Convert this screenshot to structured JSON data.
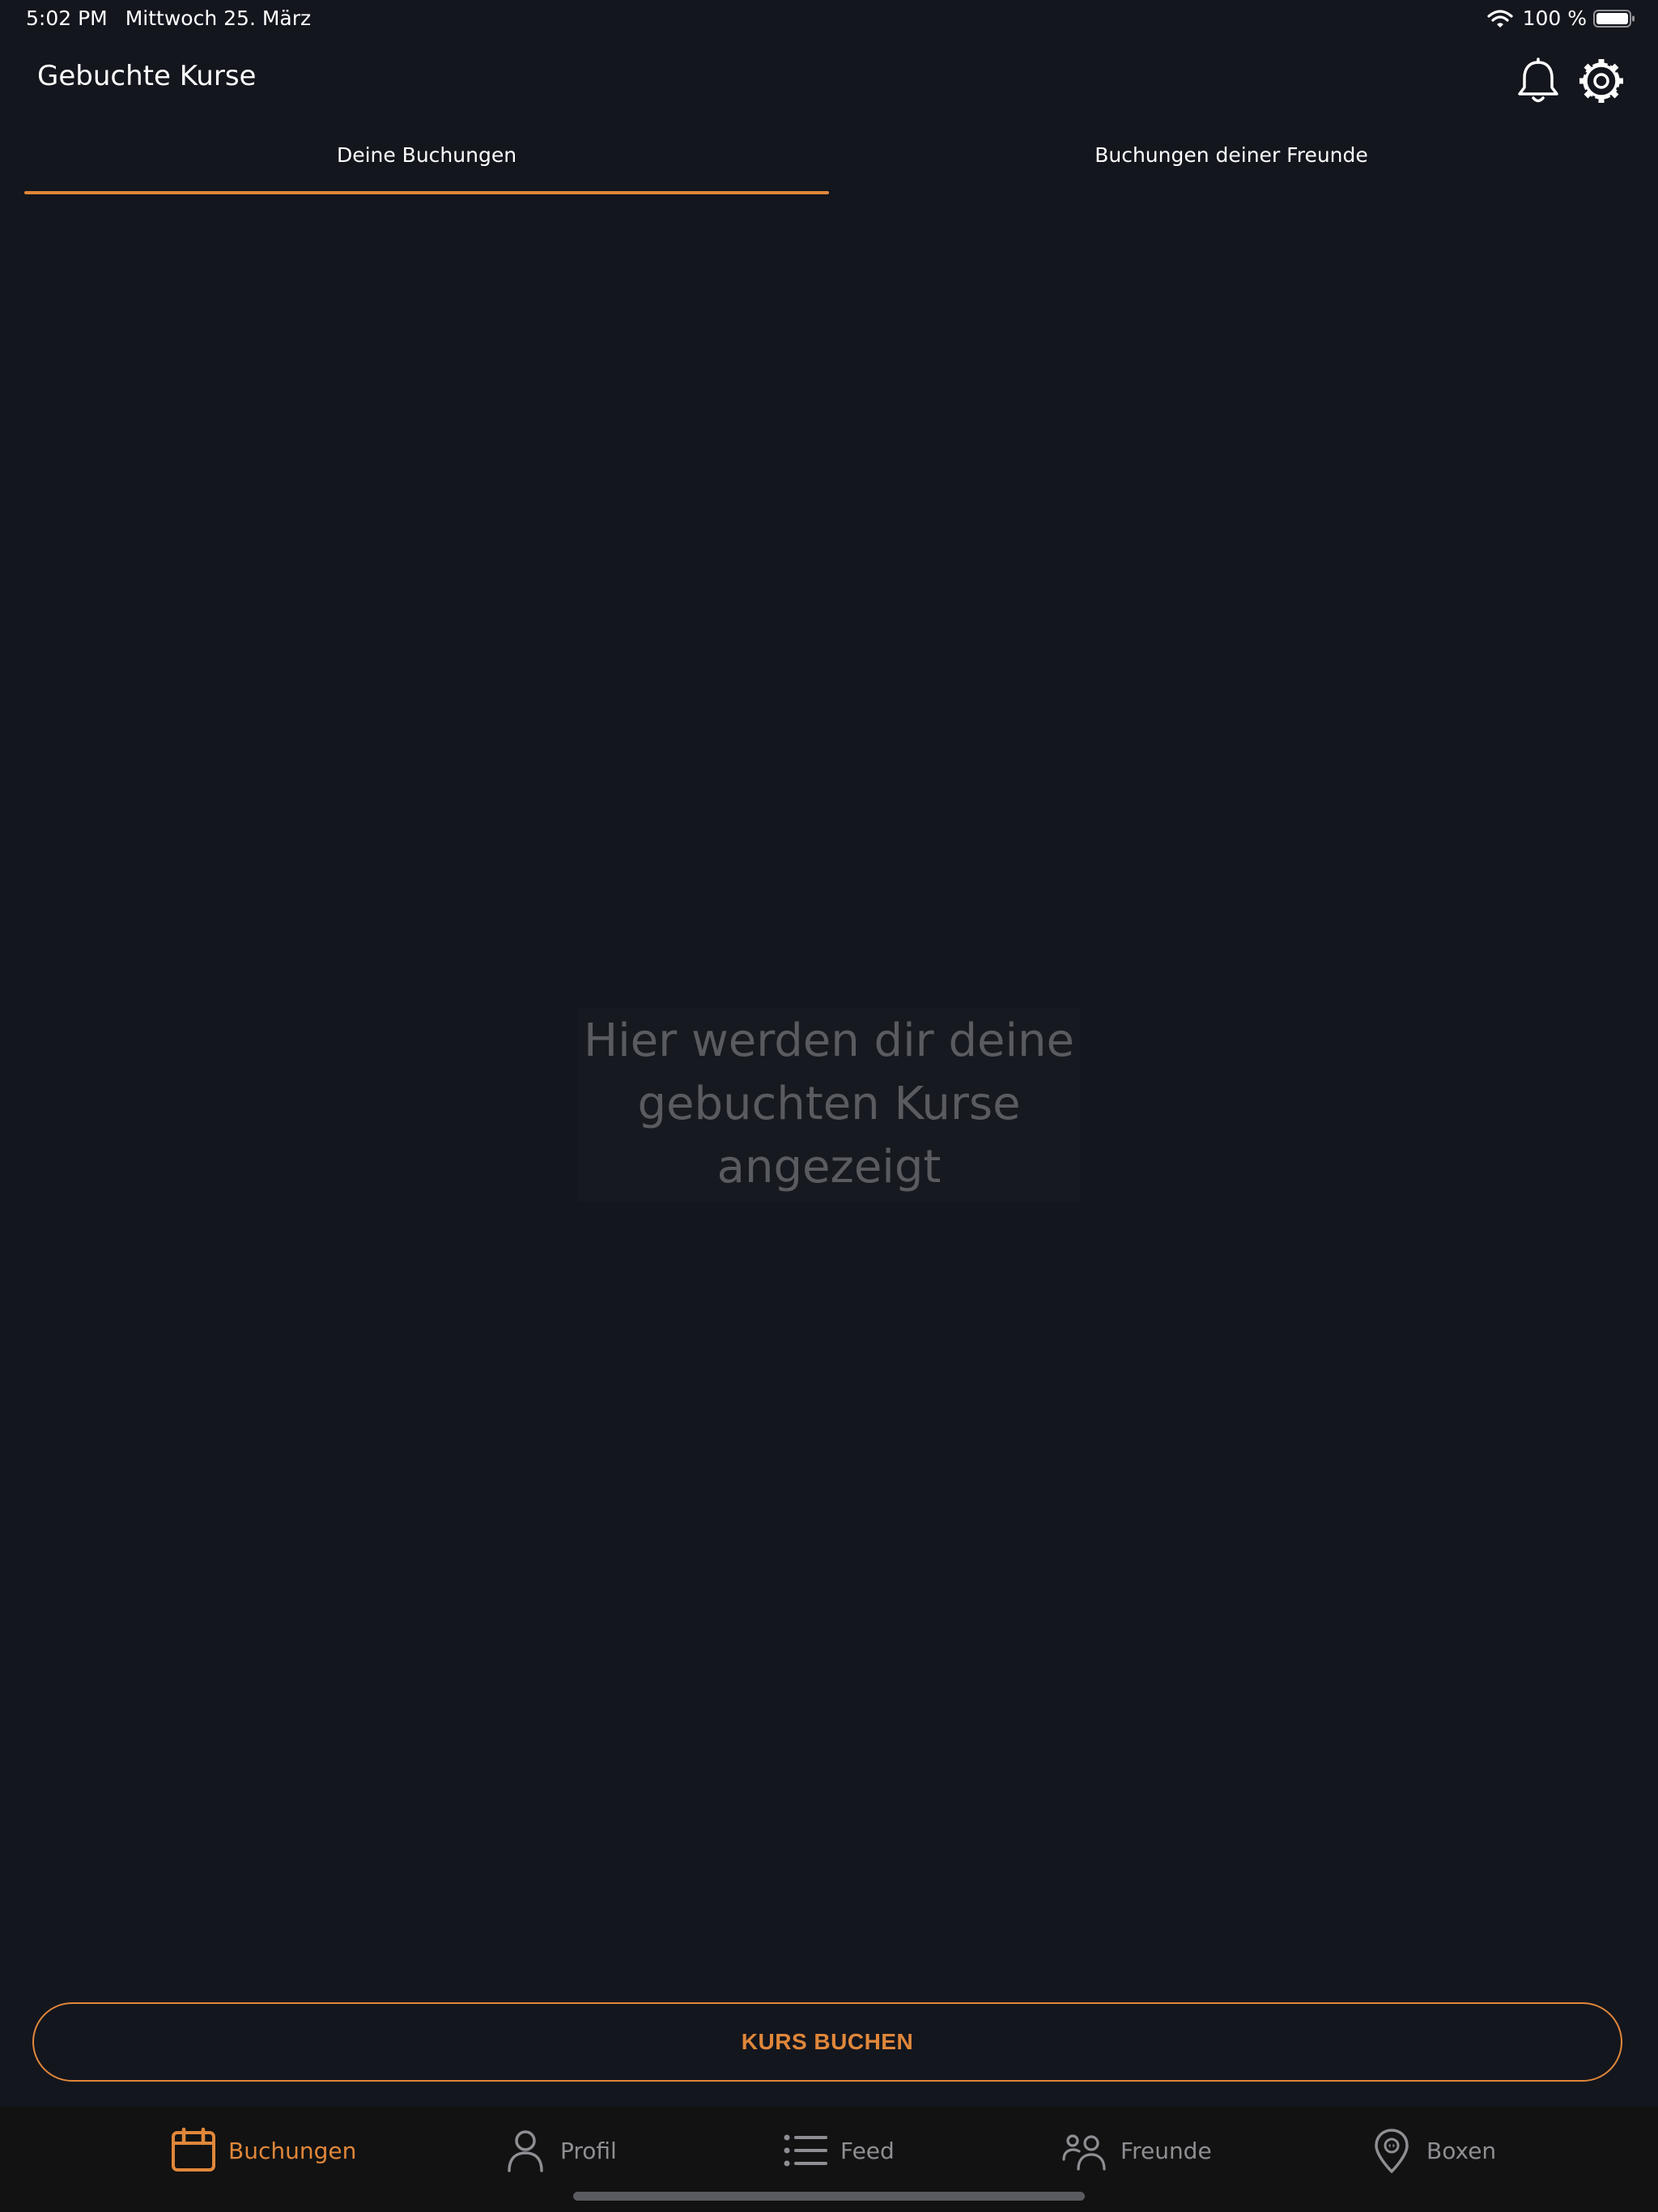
{
  "status_bar": {
    "time": "5:02 PM",
    "date": "Mittwoch 25. März",
    "battery_text": "100 %",
    "battery_level": 1.0
  },
  "header": {
    "title": "Gebuchte Kurse",
    "icons": [
      "bell-icon",
      "gear-icon"
    ]
  },
  "tabs": {
    "items": [
      {
        "label": "Deine Buchungen",
        "active": true
      },
      {
        "label": "Buchungen deiner Freunde",
        "active": false
      }
    ]
  },
  "empty_state": {
    "message": "Hier werden dir deine gebuchten Kurse angezeigt"
  },
  "cta": {
    "label": "KURS BUCHEN"
  },
  "tab_bar": {
    "items": [
      {
        "label": "Buchungen",
        "icon": "calendar-icon",
        "active": true
      },
      {
        "label": "Profil",
        "icon": "person-icon",
        "active": false
      },
      {
        "label": "Feed",
        "icon": "list-icon",
        "active": false
      },
      {
        "label": "Freunde",
        "icon": "people-icon",
        "active": false
      },
      {
        "label": "Boxen",
        "icon": "location-pin-icon",
        "active": false
      }
    ]
  },
  "colors": {
    "background": "#14161e",
    "accent": "#e0873a",
    "tab_bar_background": "#121212",
    "muted_text": "#8e8f93",
    "empty_text": "#5a5b60"
  }
}
